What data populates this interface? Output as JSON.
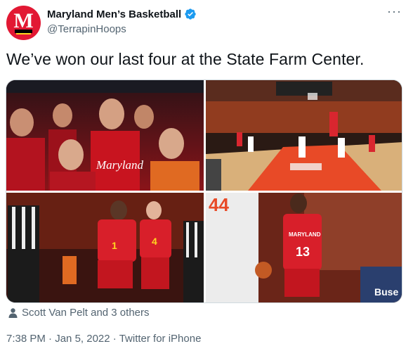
{
  "author": {
    "display_name": "Maryland Men’s Basketball",
    "handle": "@TerrapinHoops",
    "avatar_letter": "M",
    "verified": true
  },
  "tweet": {
    "text": "We’ve won our last four at the State Farm Center."
  },
  "media": {
    "photos": [
      {
        "caption": "Maryland"
      },
      {
        "caption": ""
      },
      {
        "caption": ""
      },
      {
        "caption": ""
      }
    ],
    "jersey_numbers": [
      "1",
      "4",
      "13",
      "44"
    ],
    "team_text": "MARYLAND"
  },
  "tagged": {
    "text": "Scott Van Pelt and 3 others"
  },
  "meta": {
    "time": "7:38 PM",
    "date": "Jan 5, 2022",
    "source": "Twitter for iPhone"
  },
  "colors": {
    "maryland_red": "#e21833",
    "illinois_orange": "#e84a27",
    "verified_blue": "#1d9bf0",
    "muted_text": "#536471"
  }
}
